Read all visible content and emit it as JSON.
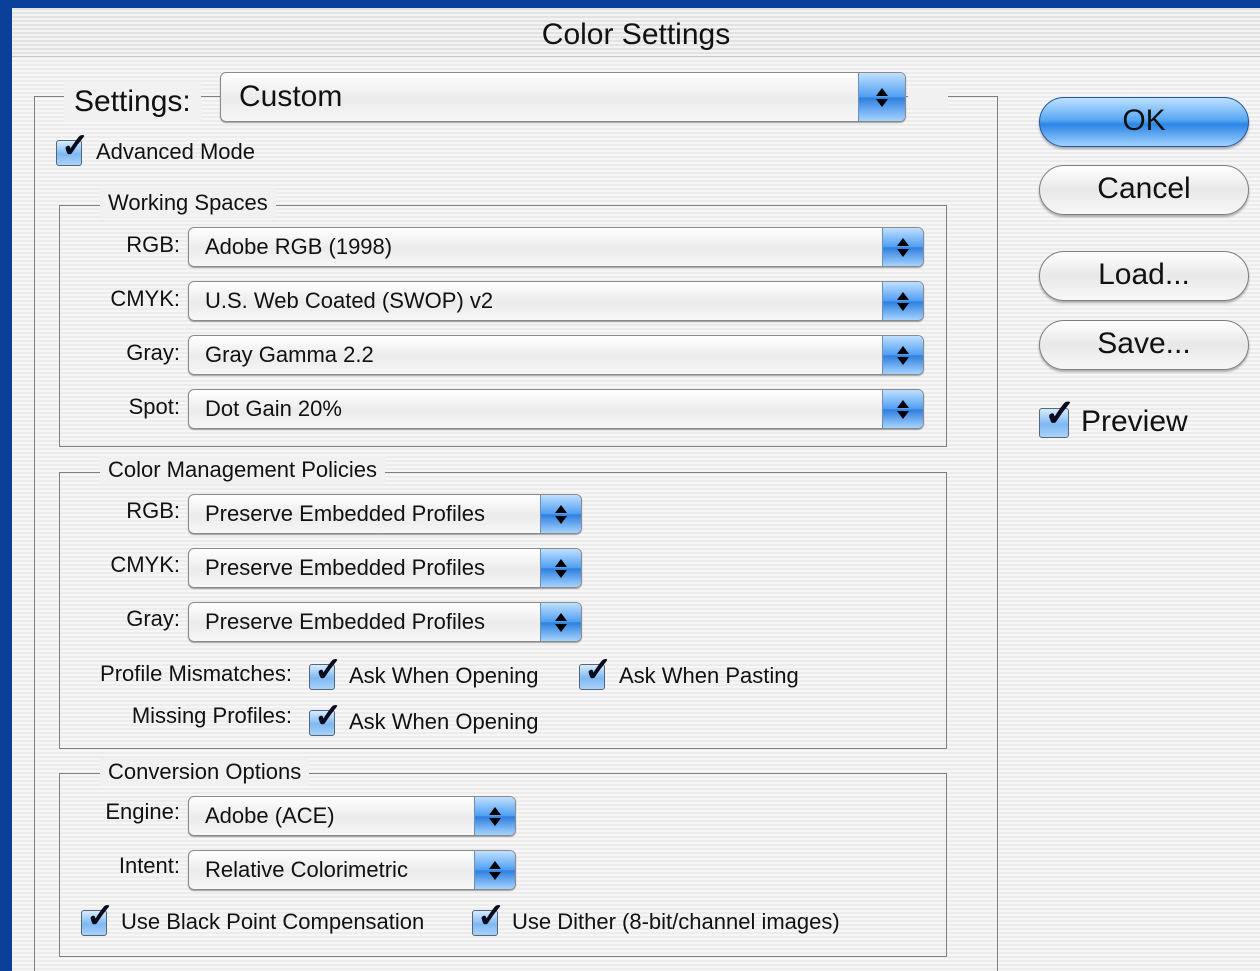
{
  "dialog": {
    "title": "Color Settings"
  },
  "settings": {
    "label": "Settings:",
    "value": "Custom"
  },
  "advanced_mode": {
    "label": "Advanced Mode",
    "checked": true
  },
  "working_spaces": {
    "title": "Working Spaces",
    "rgb": {
      "label": "RGB:",
      "value": "Adobe RGB (1998)"
    },
    "cmyk": {
      "label": "CMYK:",
      "value": "U.S. Web Coated (SWOP) v2"
    },
    "gray": {
      "label": "Gray:",
      "value": "Gray Gamma 2.2"
    },
    "spot": {
      "label": "Spot:",
      "value": "Dot Gain 20%"
    }
  },
  "policies": {
    "title": "Color Management Policies",
    "rgb": {
      "label": "RGB:",
      "value": "Preserve Embedded Profiles"
    },
    "cmyk": {
      "label": "CMYK:",
      "value": "Preserve Embedded Profiles"
    },
    "gray": {
      "label": "Gray:",
      "value": "Preserve Embedded Profiles"
    },
    "profile_mismatches": {
      "label": "Profile Mismatches:",
      "ask_opening": "Ask When Opening",
      "ask_pasting": "Ask When Pasting"
    },
    "missing_profiles": {
      "label": "Missing Profiles:",
      "ask_opening": "Ask When Opening"
    }
  },
  "conversion": {
    "title": "Conversion Options",
    "engine": {
      "label": "Engine:",
      "value": "Adobe (ACE)"
    },
    "intent": {
      "label": "Intent:",
      "value": "Relative Colorimetric"
    },
    "black_point": "Use Black Point Compensation",
    "dither": "Use Dither (8-bit/channel images)"
  },
  "buttons": {
    "ok": "OK",
    "cancel": "Cancel",
    "load": "Load...",
    "save": "Save..."
  },
  "preview": {
    "label": "Preview",
    "checked": true
  },
  "colors": {
    "accent": "#2c86e6",
    "desktop": "#0a3f9a"
  }
}
